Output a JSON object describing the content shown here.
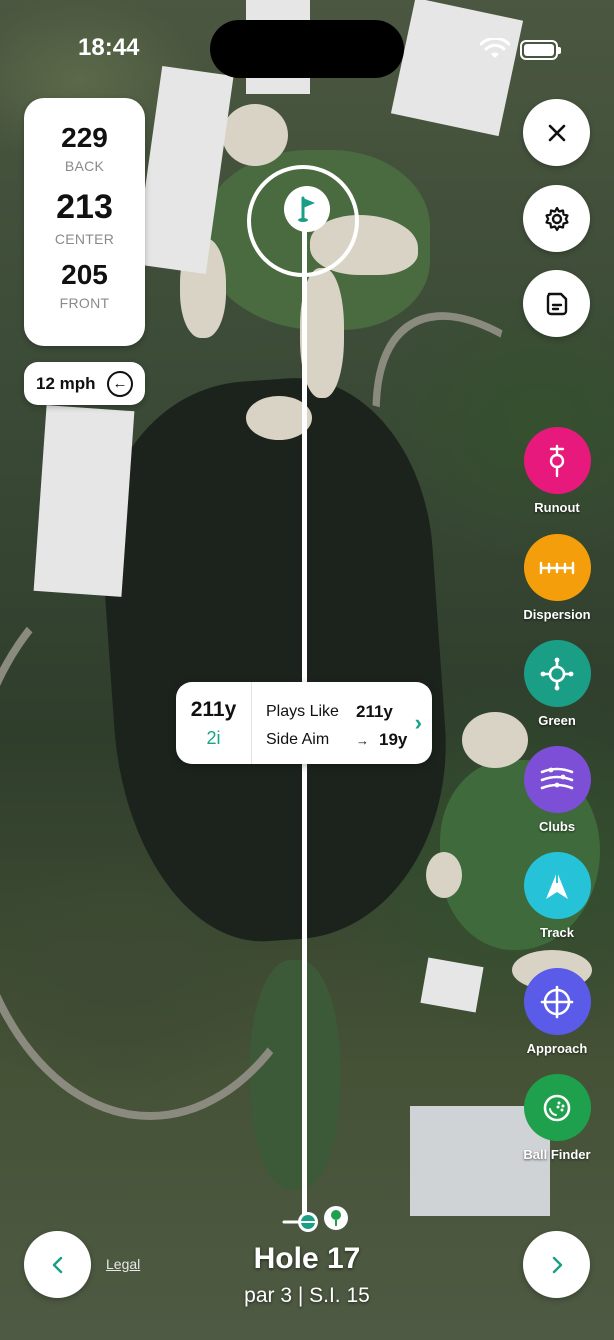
{
  "status_bar": {
    "time": "18:44"
  },
  "yardages": [
    {
      "value": "229",
      "label": "BACK"
    },
    {
      "value": "213",
      "label": "CENTER"
    },
    {
      "value": "205",
      "label": "FRONT"
    }
  ],
  "wind": {
    "speed": "12 mph",
    "icon": "arrow-left-icon",
    "arrow": "←"
  },
  "top_buttons": [
    {
      "name": "close",
      "icon": "close-icon"
    },
    {
      "name": "settings",
      "icon": "gear-icon"
    },
    {
      "name": "scorecard",
      "icon": "document-icon"
    }
  ],
  "tools": [
    {
      "label": "Runout",
      "color": "#e8197c",
      "icon": "runout-icon"
    },
    {
      "label": "Dispersion",
      "color": "#f59e0b",
      "icon": "dispersion-icon"
    },
    {
      "label": "Green",
      "color": "#1a9e86",
      "icon": "green-icon"
    },
    {
      "label": "Clubs",
      "color": "#7c4fd6",
      "icon": "clubs-icon"
    },
    {
      "label": "Track",
      "color": "#26c2d8",
      "icon": "track-icon"
    },
    {
      "label": "Approach",
      "color": "#5a5be8",
      "icon": "approach-icon"
    },
    {
      "label": "Ball Finder",
      "color": "#1fa04c",
      "icon": "ball-finder-icon"
    }
  ],
  "shot": {
    "distance": "211y",
    "club": "2i",
    "plays_like_label": "Plays Like",
    "plays_like_value": "211y",
    "side_aim_label": "Side Aim",
    "side_aim_arrow": "→",
    "side_aim_value": "19y",
    "chevron": "›"
  },
  "footer": {
    "legal": "Legal",
    "hole_title": "Hole 17",
    "hole_sub": "par 3 | S.I. 15",
    "prev": "‹",
    "next": "›"
  },
  "colors": {
    "accent": "#17a38a"
  }
}
